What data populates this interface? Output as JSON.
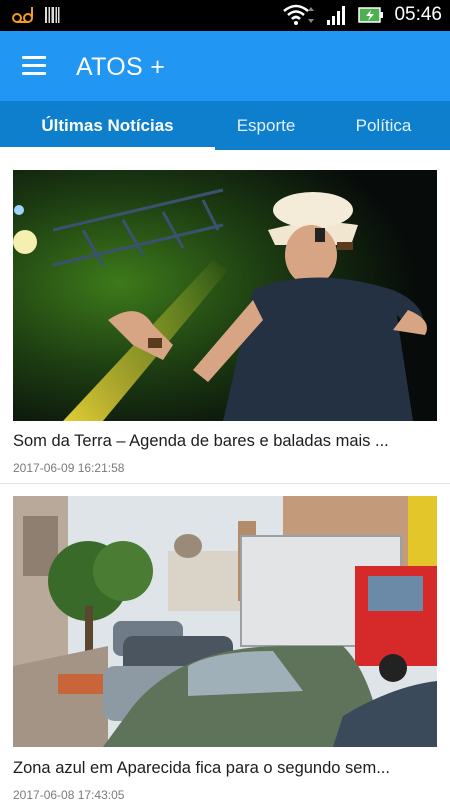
{
  "status_bar": {
    "time": "05:46",
    "icons": [
      "voicemail-icon",
      "barcode-icon",
      "wifi-icon",
      "signal-icon",
      "battery-charging-icon"
    ]
  },
  "app_bar": {
    "title": "ATOS +",
    "menu_icon": "hamburger-menu-icon"
  },
  "tabs": [
    {
      "label": "Últimas Notícias",
      "active": true
    },
    {
      "label": "Esporte",
      "active": false
    },
    {
      "label": "Política",
      "active": false
    }
  ],
  "articles": [
    {
      "title": "Som da Terra – Agenda de bares e baladas mais ...",
      "date": "2017-06-09 16:21:58",
      "image": "singer-in-cowboy-hat-on-stage-photo"
    },
    {
      "title": "Zona azul em Aparecida fica para o segundo sem...",
      "date": "2017-06-08 17:43:05",
      "image": "street-with-parked-cars-and-truck-photo"
    }
  ],
  "colors": {
    "app_bar": "#2196f3",
    "tab_bar": "#0d7fcd",
    "status_bar": "#000000"
  }
}
